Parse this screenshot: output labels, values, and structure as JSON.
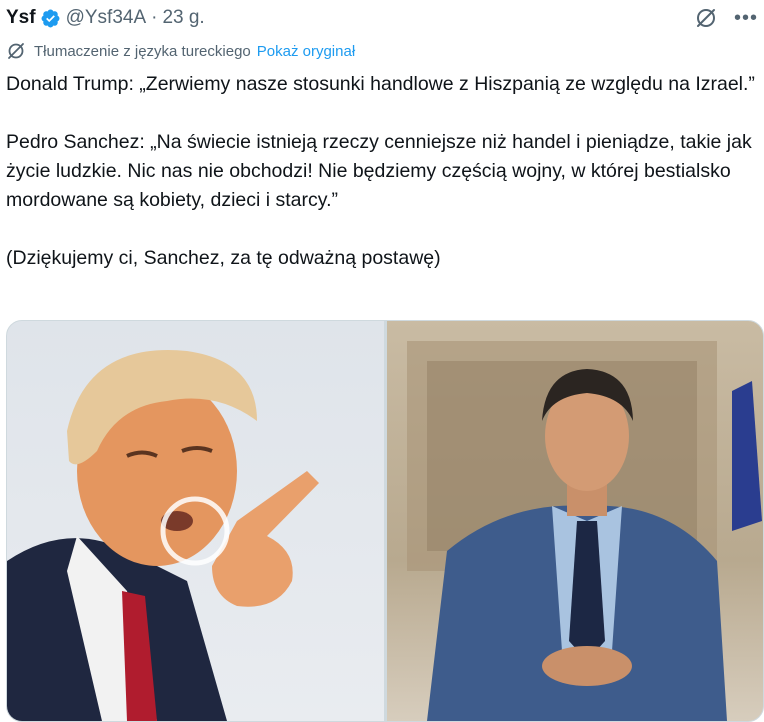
{
  "tweet": {
    "author_name": "Ysf",
    "handle": "@Ysf34A",
    "separator": "·",
    "time": "23 g.",
    "icons": {
      "verified": "verified-badge-icon",
      "grok": "grok-icon",
      "more": "more-icon"
    }
  },
  "translation": {
    "label": "Tłumaczenie z języka tureckiego",
    "show_original": "Pokaż oryginał",
    "icon": "translate-icon"
  },
  "body": {
    "para1": "Donald Trump: „Zerwiemy nasze stosunki handlowe z Hiszpanią ze względu na Izrael.”",
    "para2": "Pedro Sanchez: „Na świecie istnieją rzeczy cenniejsze niż handel i pieniądze, takie jak życie ludzkie. Nic nas nie obchodzi! Nie będziemy częścią wojny, w której bestialsko mordowane są kobiety, dzieci i starcy.”",
    "para3": "(Dziękujemy ci, Sanchez, za tę odważną postawę)"
  },
  "colors": {
    "link": "#1d9bf0",
    "secondary_text": "#536471",
    "primary_text": "#0f1419"
  }
}
